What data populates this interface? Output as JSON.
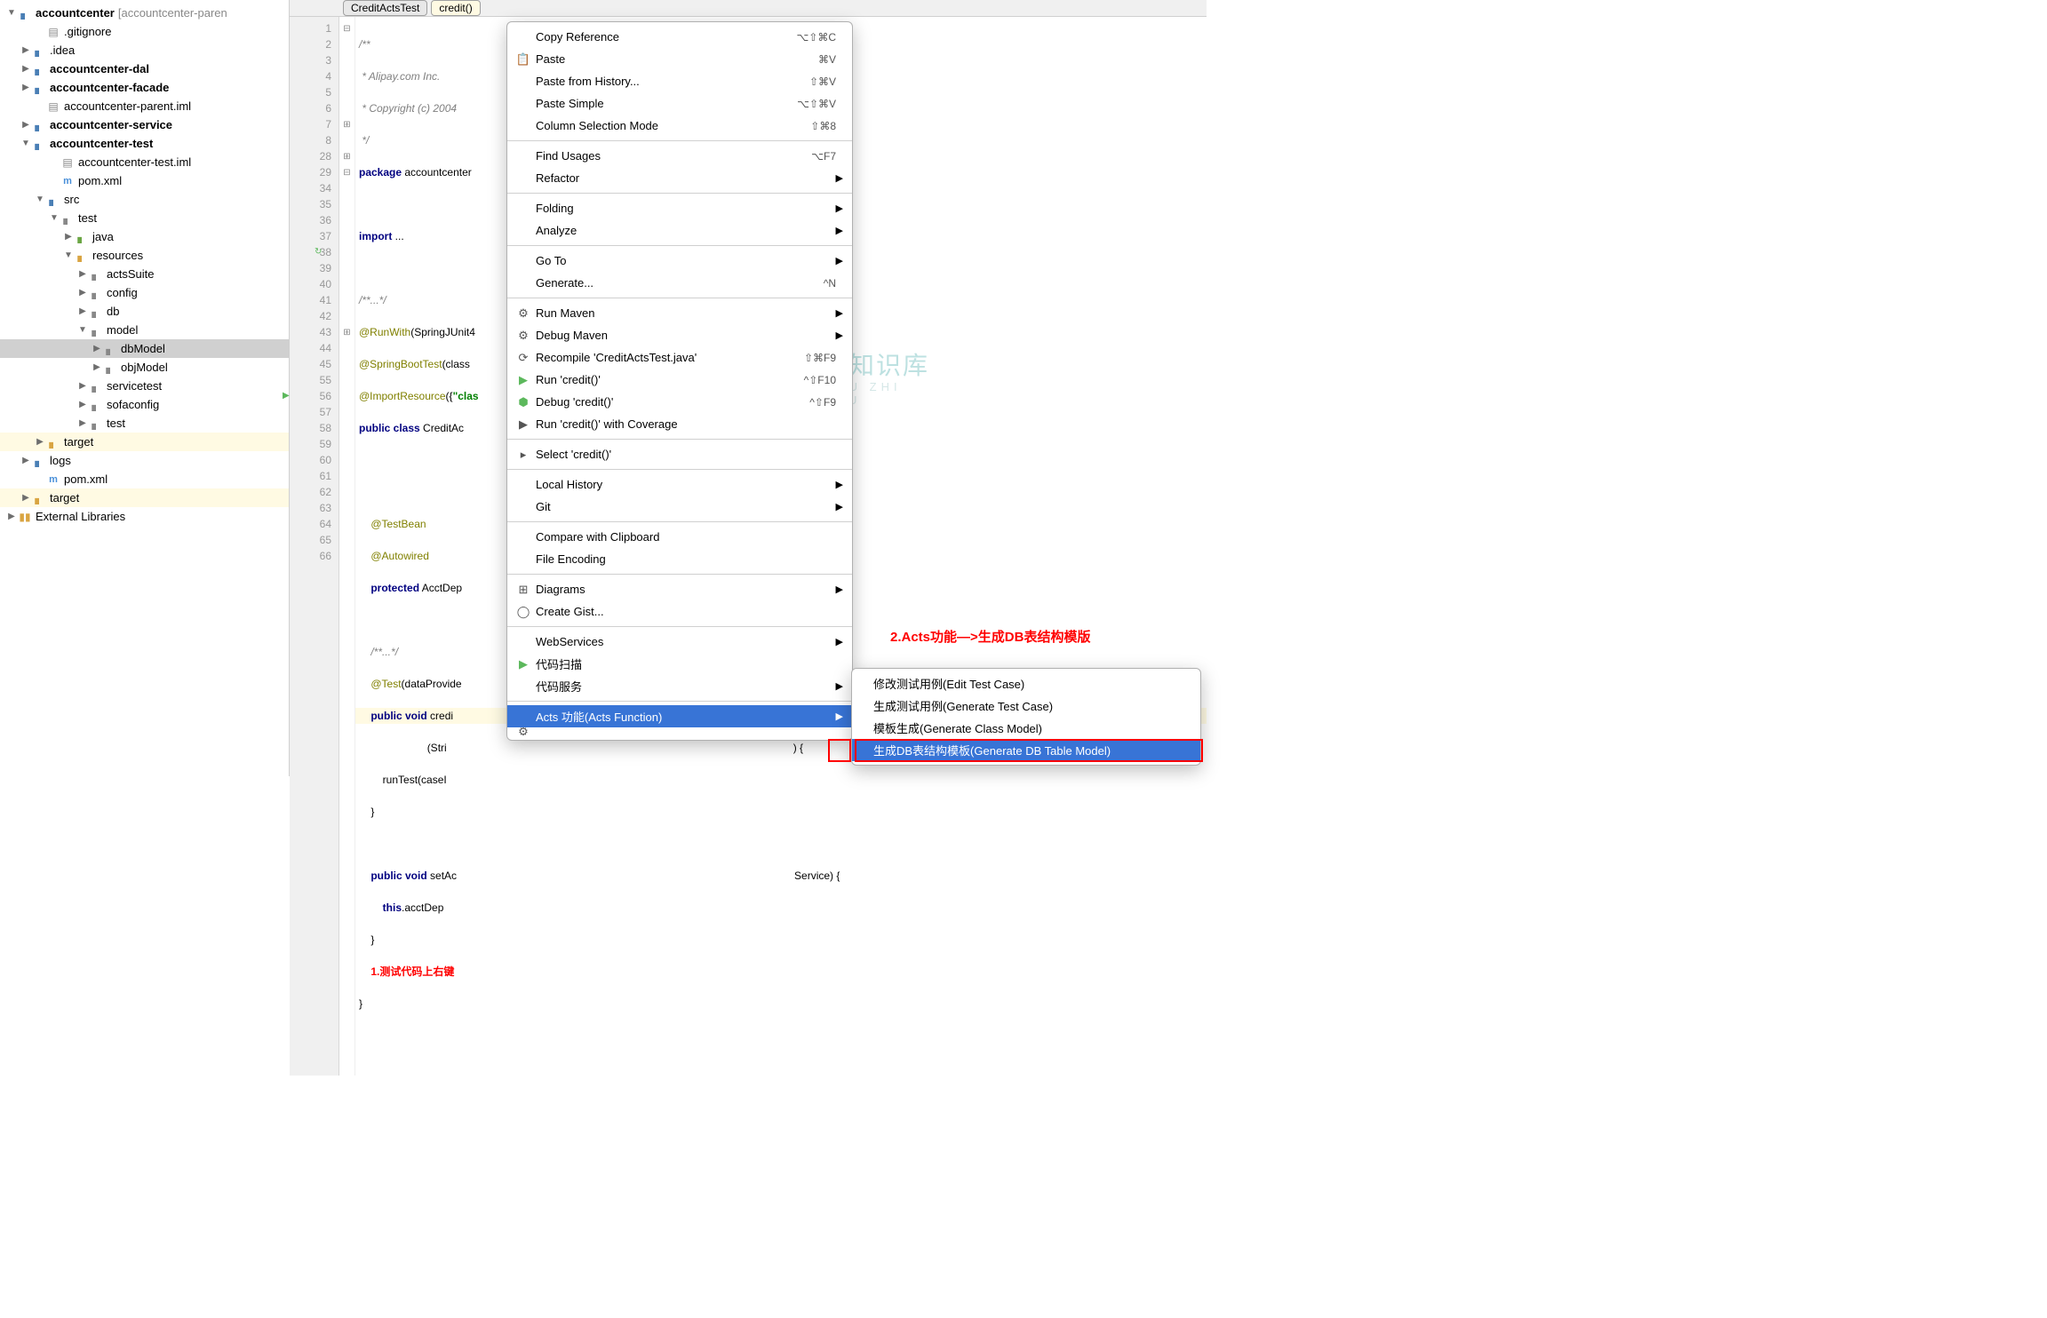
{
  "tree": {
    "root": "accountcenter",
    "root_context": "[accountcenter-paren",
    "items": [
      {
        "indent": 40,
        "arrow": "",
        "icon": "file-gray",
        "glyph": "▤",
        "label": ".gitignore"
      },
      {
        "indent": 24,
        "arrow": "▶",
        "icon": "folder-blue",
        "glyph": "▖",
        "label": ".idea"
      },
      {
        "indent": 24,
        "arrow": "▶",
        "icon": "folder-blue",
        "glyph": "▖",
        "label": "accountcenter-dal",
        "bold": true
      },
      {
        "indent": 24,
        "arrow": "▶",
        "icon": "folder-blue",
        "glyph": "▖",
        "label": "accountcenter-facade",
        "bold": true
      },
      {
        "indent": 40,
        "arrow": "",
        "icon": "file-gray",
        "glyph": "▤",
        "label": "accountcenter-parent.iml"
      },
      {
        "indent": 24,
        "arrow": "▶",
        "icon": "folder-blue",
        "glyph": "▖",
        "label": "accountcenter-service",
        "bold": true
      },
      {
        "indent": 24,
        "arrow": "▼",
        "icon": "folder-blue",
        "glyph": "▖",
        "label": "accountcenter-test",
        "bold": true
      },
      {
        "indent": 56,
        "arrow": "",
        "icon": "file-gray",
        "glyph": "▤",
        "label": "accountcenter-test.iml"
      },
      {
        "indent": 56,
        "arrow": "",
        "icon": "file-m",
        "glyph": "m",
        "label": "pom.xml"
      },
      {
        "indent": 40,
        "arrow": "▼",
        "icon": "folder-blue",
        "glyph": "▖",
        "label": "src"
      },
      {
        "indent": 56,
        "arrow": "▼",
        "icon": "folder-gray",
        "glyph": "▖",
        "label": "test"
      },
      {
        "indent": 72,
        "arrow": "▶",
        "icon": "folder-green",
        "glyph": "▖",
        "label": "java"
      },
      {
        "indent": 72,
        "arrow": "▼",
        "icon": "folder-yellow",
        "glyph": "▖",
        "label": "resources"
      },
      {
        "indent": 88,
        "arrow": "▶",
        "icon": "folder-gray",
        "glyph": "▖",
        "label": "actsSuite"
      },
      {
        "indent": 88,
        "arrow": "▶",
        "icon": "folder-gray",
        "glyph": "▖",
        "label": "config"
      },
      {
        "indent": 88,
        "arrow": "▶",
        "icon": "folder-gray",
        "glyph": "▖",
        "label": "db"
      },
      {
        "indent": 88,
        "arrow": "▼",
        "icon": "folder-gray",
        "glyph": "▖",
        "label": "model"
      },
      {
        "indent": 104,
        "arrow": "▶",
        "icon": "folder-gray",
        "glyph": "▖",
        "label": "dbModel",
        "selected": true
      },
      {
        "indent": 104,
        "arrow": "▶",
        "icon": "folder-gray",
        "glyph": "▖",
        "label": "objModel"
      },
      {
        "indent": 88,
        "arrow": "▶",
        "icon": "folder-gray",
        "glyph": "▖",
        "label": "servicetest"
      },
      {
        "indent": 88,
        "arrow": "▶",
        "icon": "folder-gray",
        "glyph": "▖",
        "label": "sofaconfig"
      },
      {
        "indent": 88,
        "arrow": "▶",
        "icon": "folder-gray",
        "glyph": "▖",
        "label": "test"
      },
      {
        "indent": 40,
        "arrow": "▶",
        "icon": "folder-yellow",
        "glyph": "▖",
        "label": "target",
        "highlighted": true
      },
      {
        "indent": 24,
        "arrow": "▶",
        "icon": "folder-blue",
        "glyph": "▖",
        "label": "logs"
      },
      {
        "indent": 40,
        "arrow": "",
        "icon": "file-m",
        "glyph": "m",
        "label": "pom.xml"
      },
      {
        "indent": 24,
        "arrow": "▶",
        "icon": "folder-yellow",
        "glyph": "▖",
        "label": "target",
        "highlighted": true
      }
    ],
    "external": "External Libraries"
  },
  "breadcrumb": {
    "a": "CreditActsTest",
    "b": "credit()"
  },
  "gutter_lines": [
    "1",
    "2",
    "3",
    "4",
    "5",
    "6",
    "7",
    "8",
    "28",
    "29",
    "34",
    "35",
    "36",
    "37",
    "38",
    "39",
    "40",
    "41",
    "42",
    "43",
    "44",
    "45",
    "55",
    "56",
    "57",
    "58",
    "59",
    "60",
    "61",
    "62",
    "63",
    "64",
    "65",
    "66"
  ],
  "code": {
    "l1": "/**",
    "l2": " * Alipay.com Inc.",
    "l3": " * Copyright (c) 2004",
    "l4": " */",
    "l5a": "package",
    "l5b": " accountcenter",
    "l7a": "import",
    "l7b": " ...",
    "l9": "/**...*/",
    "l10": "@RunWith",
    "l10b": "(SpringJUnit4",
    "l11": "@SpringBootTest",
    "l11b": "(class",
    "l12": "@ImportResource",
    "l12b": "({",
    "l12c": "\"clas",
    "l13a": "public class",
    "l13b": " CreditAc",
    "l15": "@TestBean",
    "l16": "@Autowired",
    "l17a": "protected",
    "l17b": " AcctDep",
    "l19": "/**...*/",
    "l20": "@Test",
    "l20b": "(dataProvide",
    "l21a": "public void",
    "l21b": " credi",
    "l22": "(Stri",
    "l23": "runTest(caseI",
    "l24": "}",
    "l26a": "public void",
    "l26b": " setAc",
    "l26c": "Service) {",
    "l27a": "this",
    "l27b": ".acctDep",
    "l28": "}",
    "l29a": "1.测试代码上右键",
    "l29b": "}"
  },
  "annotation2": "2.Acts功能—>生成DB表结构模版",
  "watermark": {
    "main": "小牛知识库",
    "sub": "XIAO  U ZHI SHI KU"
  },
  "menu": [
    {
      "label": "Copy Reference",
      "shortcut": "⌥⇧⌘C"
    },
    {
      "icon": "📋",
      "label": "Paste",
      "shortcut": "⌘V"
    },
    {
      "label": "Paste from History...",
      "shortcut": "⇧⌘V"
    },
    {
      "label": "Paste Simple",
      "shortcut": "⌥⇧⌘V"
    },
    {
      "label": "Column Selection Mode",
      "shortcut": "⇧⌘8"
    },
    {
      "sep": true
    },
    {
      "label": "Find Usages",
      "shortcut": "⌥F7"
    },
    {
      "label": "Refactor",
      "arrow": true
    },
    {
      "sep": true
    },
    {
      "label": "Folding",
      "arrow": true
    },
    {
      "label": "Analyze",
      "arrow": true
    },
    {
      "sep": true
    },
    {
      "label": "Go To",
      "arrow": true
    },
    {
      "label": "Generate...",
      "shortcut": "^N"
    },
    {
      "sep": true
    },
    {
      "icon": "⚙",
      "label": "Run Maven",
      "arrow": true
    },
    {
      "icon": "⚙",
      "label": "Debug Maven",
      "arrow": true
    },
    {
      "icon": "⟳",
      "label": "Recompile 'CreditActsTest.java'",
      "shortcut": "⇧⌘F9"
    },
    {
      "icon": "▶",
      "iconColor": "#5cb85c",
      "label": "Run 'credit()'",
      "shortcut": "^⇧F10"
    },
    {
      "icon": "⬢",
      "iconColor": "#5cb85c",
      "label": "Debug 'credit()'",
      "shortcut": "^⇧F9"
    },
    {
      "icon": "▶",
      "label": "Run 'credit()' with Coverage"
    },
    {
      "sep": true
    },
    {
      "icon": "▸",
      "label": "Select 'credit()'"
    },
    {
      "sep": true
    },
    {
      "label": "Local History",
      "arrow": true
    },
    {
      "label": "Git",
      "arrow": true
    },
    {
      "sep": true
    },
    {
      "label": "Compare with Clipboard"
    },
    {
      "label": "File Encoding"
    },
    {
      "sep": true
    },
    {
      "icon": "⊞",
      "label": "Diagrams",
      "arrow": true
    },
    {
      "icon": "◯",
      "label": "Create Gist..."
    },
    {
      "sep": true
    },
    {
      "label": "WebServices",
      "arrow": true
    },
    {
      "icon": "▶",
      "iconColor": "#5cb85c",
      "label": "代码扫描"
    },
    {
      "label": "代码服务",
      "arrow": true
    },
    {
      "sep": true
    },
    {
      "label": "Acts 功能(Acts Function)",
      "arrow": true,
      "selected": true
    }
  ],
  "submenu": [
    {
      "label": "修改测试用例(Edit Test Case)"
    },
    {
      "label": "生成测试用例(Generate Test Case)"
    },
    {
      "label": "模板生成(Generate Class Model)"
    },
    {
      "label": "生成DB表结构模板(Generate DB Table Model)",
      "selected": true
    }
  ]
}
